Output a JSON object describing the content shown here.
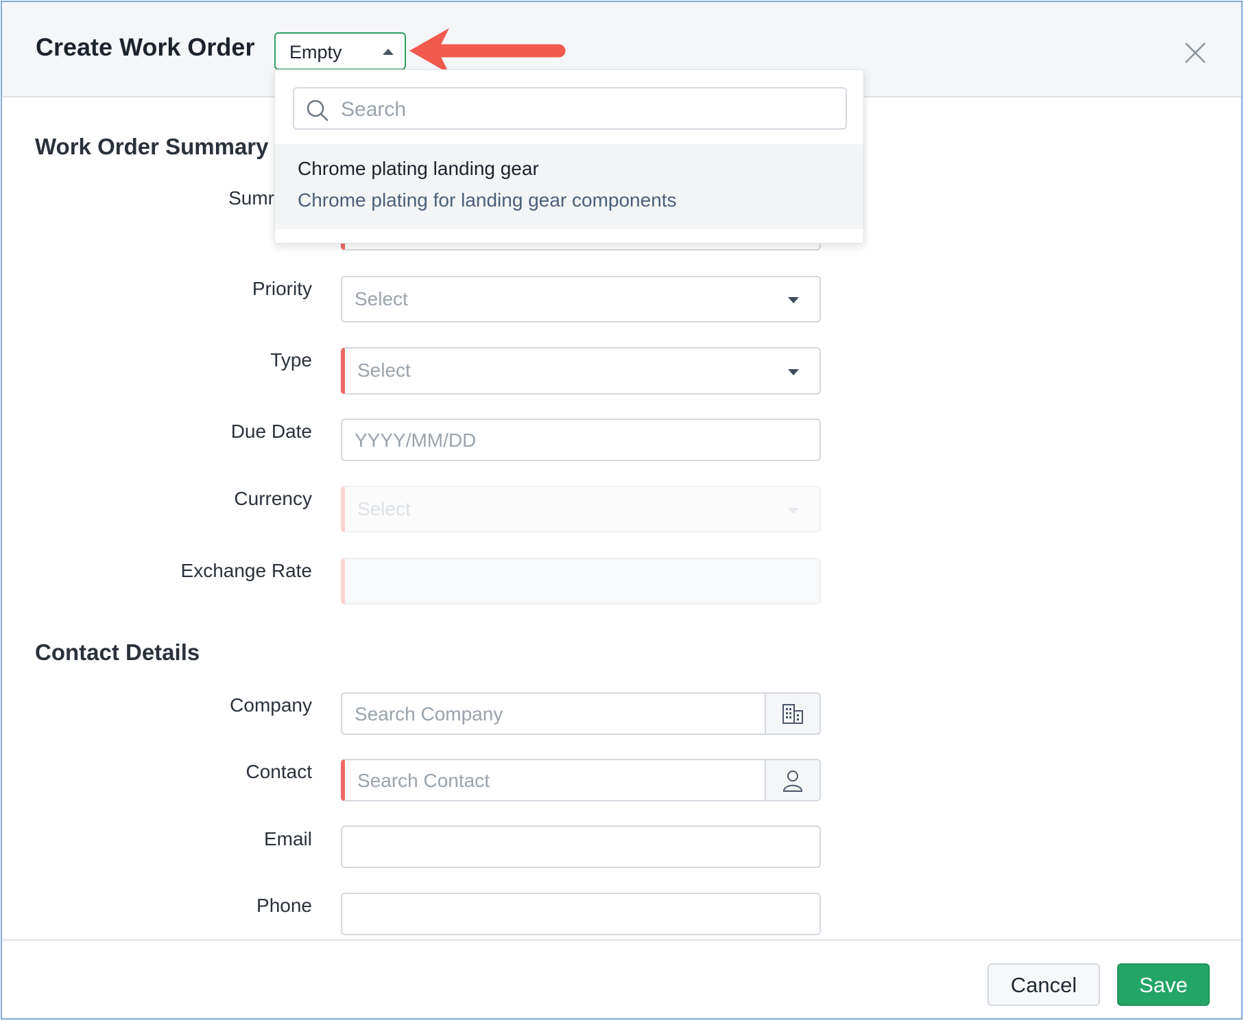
{
  "header": {
    "title": "Create Work Order",
    "template_select": {
      "value": "Empty"
    }
  },
  "template_dropdown": {
    "search_placeholder": "Search",
    "options": [
      {
        "name": "Chrome plating landing gear",
        "description": "Chrome plating for landing gear components"
      }
    ]
  },
  "summary_section": {
    "title": "Work Order Summary",
    "fields": {
      "summary": {
        "label": "Summary",
        "visible_label": "Sumr"
      },
      "priority": {
        "label": "Priority",
        "placeholder": "Select"
      },
      "type": {
        "label": "Type",
        "placeholder": "Select"
      },
      "due_date": {
        "label": "Due Date",
        "placeholder": "YYYY/MM/DD"
      },
      "currency": {
        "label": "Currency",
        "placeholder": "Select"
      },
      "exchange_rate": {
        "label": "Exchange Rate",
        "value": ""
      }
    }
  },
  "contact_section": {
    "title": "Contact Details",
    "fields": {
      "company": {
        "label": "Company",
        "placeholder": "Search Company",
        "icon": "building-icon"
      },
      "contact": {
        "label": "Contact",
        "placeholder": "Search Contact",
        "icon": "person-icon"
      },
      "email": {
        "label": "Email",
        "value": ""
      },
      "phone": {
        "label": "Phone",
        "value": ""
      }
    }
  },
  "footer": {
    "cancel_label": "Cancel",
    "save_label": "Save"
  },
  "colors": {
    "accent_green": "#23a565",
    "required_red": "#ee6b63",
    "annotation_arrow": "#f15a4c"
  }
}
